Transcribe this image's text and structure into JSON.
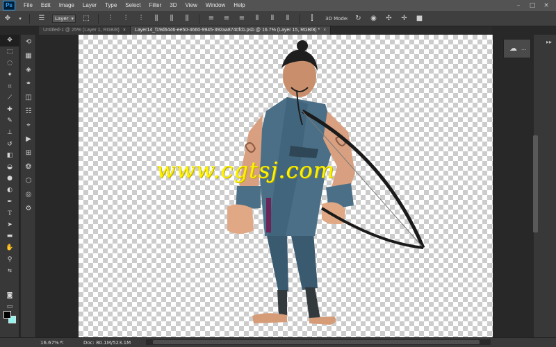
{
  "app": {
    "logo": "Ps",
    "menu": [
      "File",
      "Edit",
      "Image",
      "Layer",
      "Type",
      "Select",
      "Filter",
      "3D",
      "View",
      "Window",
      "Help"
    ],
    "window_controls": [
      "–",
      "□",
      "×"
    ]
  },
  "options_bar": {
    "auto_select_value": "Layer",
    "mode_label": "3D Mode:",
    "icons": [
      "move-tool-icon",
      "auto-select-icon",
      "transform-controls-icon",
      "align-icons",
      "distribute-icons",
      "3d-rotate-icon",
      "3d-roll-icon",
      "3d-pan-icon",
      "3d-slide-icon",
      "3d-scale-icon"
    ]
  },
  "tabs": [
    {
      "label": "Untitled-1 @ 25% (Layer 1, RGB/8)",
      "close": "×",
      "active": false
    },
    {
      "label": "Layer14_f19d6446-ee50-4660-9945-392aa8740fcb.psb @ 16.7% (Layer 15, RGB/8) *",
      "close": "×",
      "active": true
    }
  ],
  "canvas": {
    "watermark": "www.cgtsj.com"
  },
  "status": {
    "zoom": "16.67%",
    "doc": "Doc: 80.1M/523.1M",
    "arrow": "▶"
  },
  "panel": {
    "more": "..."
  },
  "colors": {
    "foreground": "#000000",
    "background": "#8ff5f0",
    "watermark": "#fff200"
  }
}
